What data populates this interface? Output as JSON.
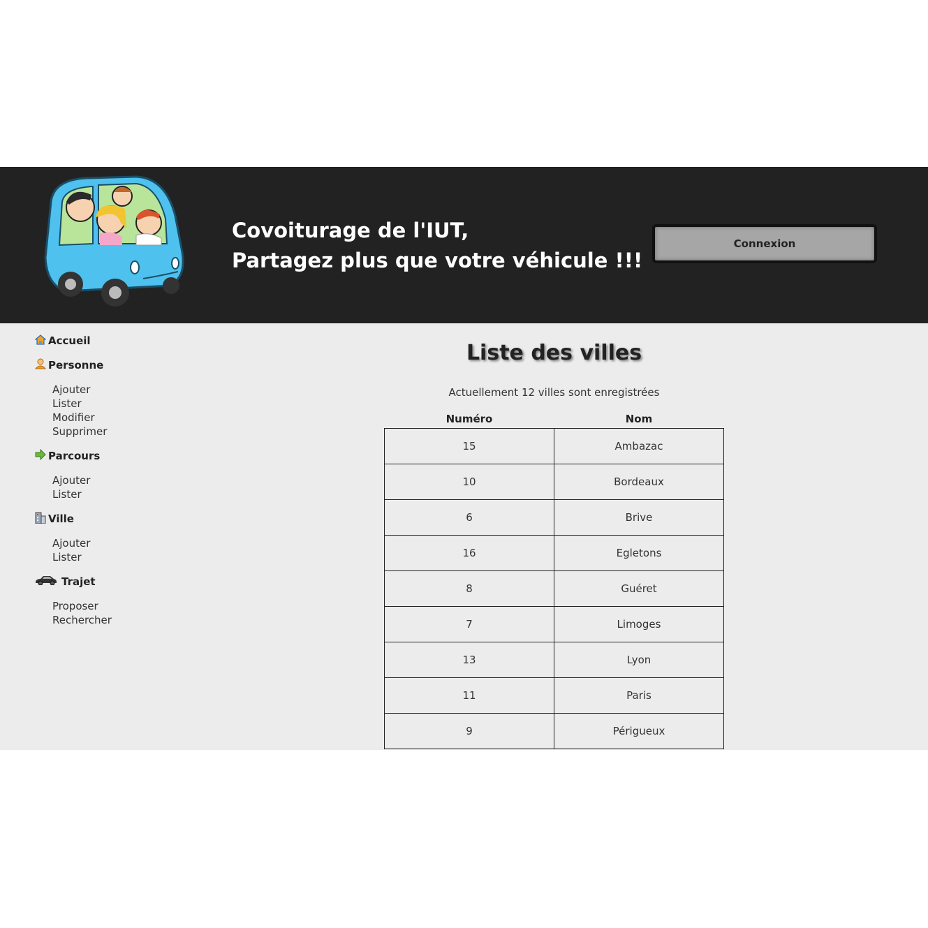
{
  "header": {
    "slogan_line1": "Covoiturage de l'IUT,",
    "slogan_line2": "Partagez plus que votre véhicule !!!",
    "login_button": "Connexion"
  },
  "sidebar": {
    "accueil": "Accueil",
    "personne": {
      "label": "Personne",
      "items": [
        "Ajouter",
        "Lister",
        "Modifier",
        "Supprimer"
      ]
    },
    "parcours": {
      "label": "Parcours",
      "items": [
        "Ajouter",
        "Lister"
      ]
    },
    "ville": {
      "label": "Ville",
      "items": [
        "Ajouter",
        "Lister"
      ]
    },
    "trajet": {
      "label": "Trajet",
      "items": [
        "Proposer",
        "Rechercher"
      ]
    }
  },
  "main": {
    "title": "Liste des villes",
    "count_text": "Actuellement 12 villes sont enregistrées",
    "columns": [
      "Numéro",
      "Nom"
    ],
    "rows": [
      [
        "15",
        "Ambazac"
      ],
      [
        "10",
        "Bordeaux"
      ],
      [
        "6",
        "Brive"
      ],
      [
        "16",
        "Egletons"
      ],
      [
        "8",
        "Guéret"
      ],
      [
        "7",
        "Limoges"
      ],
      [
        "13",
        "Lyon"
      ],
      [
        "11",
        "Paris"
      ],
      [
        "9",
        "Périgueux"
      ]
    ]
  },
  "colors": {
    "header_bg": "#222222",
    "page_bg": "#ececec",
    "button_bg": "#a6a6a6",
    "car_blue": "#4fc1ef"
  },
  "icons": {
    "accueil": "home-icon",
    "personne": "person-icon",
    "parcours": "arrow-right-icon",
    "ville": "building-icon",
    "trajet": "car-icon"
  }
}
